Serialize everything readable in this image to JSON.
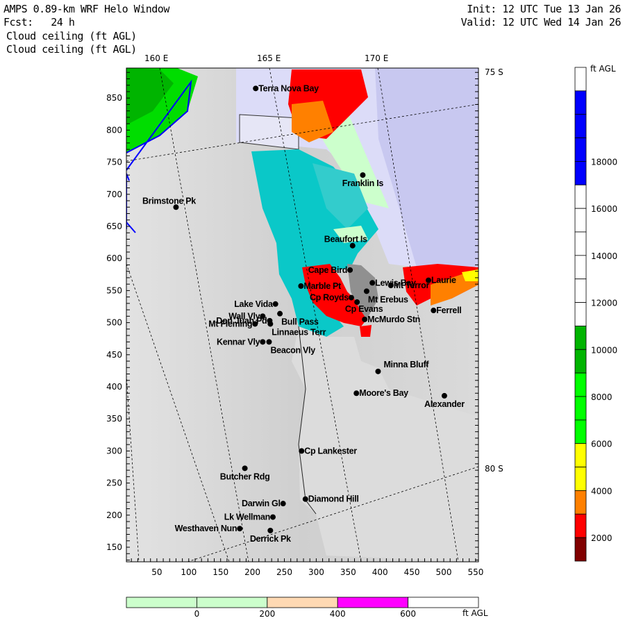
{
  "header": {
    "title": "AMPS 0.89-km WRF Helo Window",
    "forecast": "Fcst:   24 h",
    "field1": "Cloud ceiling (ft AGL)",
    "field2": "Cloud ceiling (ft AGL)",
    "init": "Init: 12 UTC Tue 13 Jan 26",
    "valid": "Valid: 12 UTC Wed 14 Jan 26"
  },
  "chart_data": {
    "type": "map",
    "x_range": [
      0,
      553
    ],
    "y_range": [
      127,
      897
    ],
    "x_ticks": [
      50,
      100,
      150,
      200,
      250,
      300,
      350,
      400,
      450,
      500,
      550
    ],
    "y_ticks": [
      150,
      200,
      250,
      300,
      350,
      400,
      450,
      500,
      550,
      600,
      650,
      700,
      750,
      800,
      850
    ],
    "longitude_labels": [
      "160 E",
      "165 E",
      "170 E"
    ],
    "latitude_labels": [
      "75 S",
      "80 S"
    ],
    "stations": [
      {
        "name": "Terra Nova Bay",
        "x": 205,
        "y": 865,
        "anchor": "right"
      },
      {
        "name": "Franklin Is",
        "x": 373,
        "y": 730,
        "anchor": "below"
      },
      {
        "name": "Brimstone Pk",
        "x": 80,
        "y": 680,
        "anchor": "above"
      },
      {
        "name": "Beaufort Is",
        "x": 357,
        "y": 620,
        "anchor": "above"
      },
      {
        "name": "Cape Bird",
        "x": 353,
        "y": 582,
        "anchor": "left"
      },
      {
        "name": "Marble Pt",
        "x": 276,
        "y": 557,
        "anchor": "right"
      },
      {
        "name": "Lewis Bay",
        "x": 388,
        "y": 562,
        "anchor": "right"
      },
      {
        "name": "Mt Terror",
        "x": 417,
        "y": 558,
        "anchor": "right"
      },
      {
        "name": "Laurie",
        "x": 476,
        "y": 566,
        "anchor": "right"
      },
      {
        "name": "Mt Erebus",
        "x": 379,
        "y": 549,
        "anchor": "belowright"
      },
      {
        "name": "Cp Royds",
        "x": 355,
        "y": 539,
        "anchor": "left"
      },
      {
        "name": "Cp Evans",
        "x": 364,
        "y": 532,
        "anchor": "belowleft"
      },
      {
        "name": "Lake Vida",
        "x": 236,
        "y": 529,
        "anchor": "left"
      },
      {
        "name": "Ferrell",
        "x": 484,
        "y": 519,
        "anchor": "right"
      },
      {
        "name": "Bull Pass",
        "x": 243,
        "y": 514,
        "anchor": "belowright"
      },
      {
        "name": "Wall Vly",
        "x": 216,
        "y": 510,
        "anchor": "left"
      },
      {
        "name": "McMurdo Stn",
        "x": 376,
        "y": 505,
        "anchor": "right"
      },
      {
        "name": "Don Juan Pd",
        "x": 227,
        "y": 503,
        "anchor": "left"
      },
      {
        "name": "Linnaeus Terr",
        "x": 228,
        "y": 498,
        "anchor": "belowright"
      },
      {
        "name": "Mt Fleming",
        "x": 204,
        "y": 498,
        "anchor": "left"
      },
      {
        "name": "Kennar Vly",
        "x": 216,
        "y": 470,
        "anchor": "left"
      },
      {
        "name": "Beacon Vly",
        "x": 226,
        "y": 470,
        "anchor": "belowright"
      },
      {
        "name": "Minna Bluff",
        "x": 397,
        "y": 424,
        "anchor": "aboveright"
      },
      {
        "name": "Moore's Bay",
        "x": 363,
        "y": 390,
        "anchor": "right"
      },
      {
        "name": "Alexander",
        "x": 501,
        "y": 386,
        "anchor": "below"
      },
      {
        "name": "Cp Lankester",
        "x": 277,
        "y": 300,
        "anchor": "right"
      },
      {
        "name": "Butcher Rdg",
        "x": 188,
        "y": 273,
        "anchor": "below"
      },
      {
        "name": "Diamond Hill",
        "x": 283,
        "y": 225,
        "anchor": "right"
      },
      {
        "name": "Darwin Gl",
        "x": 248,
        "y": 218,
        "anchor": "left"
      },
      {
        "name": "Lk Wellman",
        "x": 232,
        "y": 197,
        "anchor": "left"
      },
      {
        "name": "Westhaven Nun",
        "x": 180,
        "y": 179,
        "anchor": "left"
      },
      {
        "name": "Derrick Pk",
        "x": 228,
        "y": 176,
        "anchor": "below"
      }
    ],
    "colorbar": {
      "unit": "ft AGL",
      "levels_top_to_bottom": [
        "#ffffff",
        "#0000ff",
        "#0000ff",
        "#0000ff",
        "#0000ff",
        "#ffffff",
        "#ffffff",
        "#ffffff",
        "#ffffff",
        "#ffffff",
        "#ffffff",
        "#00b400",
        "#00b400",
        "#00ff00",
        "#00ff00",
        "#00ff00",
        "#ffff00",
        "#ffff00",
        "#ff8000",
        "#ff0000",
        "#800000"
      ],
      "labels": [
        "18000",
        "16000",
        "14000",
        "12000",
        "10000",
        "8000",
        "6000",
        "4000",
        "2000"
      ]
    },
    "terrain_colorbar": {
      "unit": "ft AGL",
      "colors": [
        "#ccffcc",
        "#ccffcc",
        "#ffd9b3",
        "#ff00ff",
        "#ffffff"
      ],
      "labels": [
        "0",
        "200",
        "400",
        "600"
      ]
    }
  }
}
